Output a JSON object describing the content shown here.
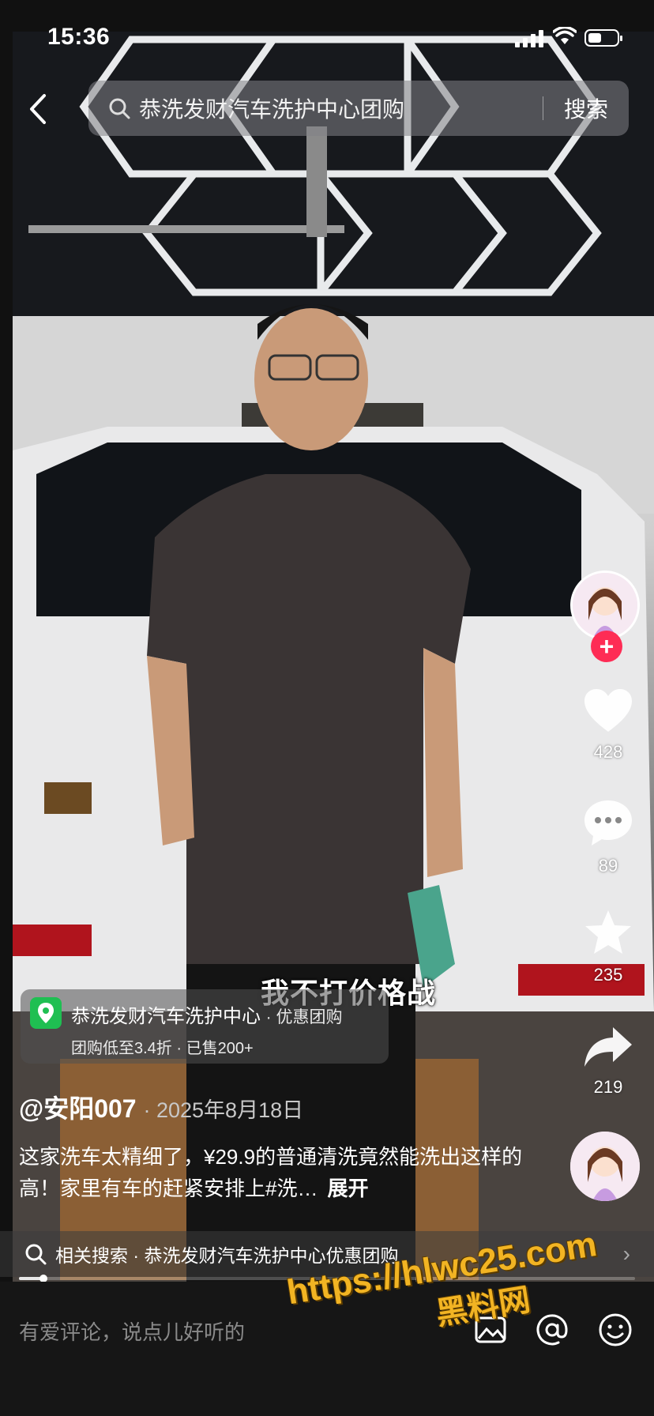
{
  "status_bar": {
    "time": "15:36"
  },
  "search": {
    "query": "恭洗发财汽车洗护中心团购",
    "button_label": "搜索"
  },
  "video": {
    "caption": "我不打价格战"
  },
  "actions": {
    "likes": "428",
    "comments": "89",
    "favorites": "235",
    "shares": "219"
  },
  "poi": {
    "name": "恭洗发财汽车洗护中心",
    "tag": "· 优惠团购",
    "info": "团购低至3.4折 · 已售200+"
  },
  "post": {
    "author": "@安阳007",
    "date": "· 2025年8月18日",
    "description": "这家洗车太精细了，¥29.9的普通清洗竟然能洗出这样的高！家里有车的赶紧安排上#洗…",
    "expand_label": "展开"
  },
  "related": {
    "text": "相关搜索 · 恭洗发财汽车洗护中心优惠团购"
  },
  "playback": {
    "progress": 0.04
  },
  "comment_bar": {
    "placeholder": "有爱评论，说点儿好听的"
  },
  "watermark": {
    "url": "https://hlwc25.com",
    "name": "黑料网"
  },
  "colors": {
    "follow_red": "#fe2c55",
    "poi_green": "#1fbf52",
    "watermark_gold": "#f2b423"
  },
  "icons": [
    "back-arrow-icon",
    "search-icon",
    "heart-icon",
    "comment-icon",
    "star-icon",
    "share-icon",
    "image-icon",
    "at-icon",
    "emoji-icon",
    "location-pin-icon"
  ]
}
